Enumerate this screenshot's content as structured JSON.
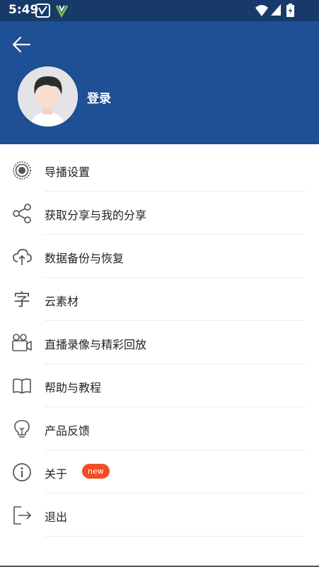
{
  "status_bar": {
    "time": "5:49"
  },
  "header": {
    "login_label": "登录",
    "accent": "#1f4f94"
  },
  "menu": {
    "items": [
      {
        "label": "导播设置",
        "icon": "broadcast-icon"
      },
      {
        "label": "获取分享与我的分享",
        "icon": "share-icon"
      },
      {
        "label": "数据备份与恢复",
        "icon": "cloud-upload-icon"
      },
      {
        "label": "云素材",
        "icon": "font-char-icon",
        "icon_glyph": "字"
      },
      {
        "label": "直播录像与精彩回放",
        "icon": "video-camera-icon"
      },
      {
        "label": "帮助与教程",
        "icon": "book-icon"
      },
      {
        "label": "产品反馈",
        "icon": "lightbulb-icon"
      },
      {
        "label": "关于",
        "icon": "info-icon",
        "badge": "new"
      },
      {
        "label": "退出",
        "icon": "logout-icon"
      }
    ]
  },
  "colors": {
    "badge": "#f04e23",
    "status_bar": "#173a6b",
    "icon": "#555555"
  }
}
